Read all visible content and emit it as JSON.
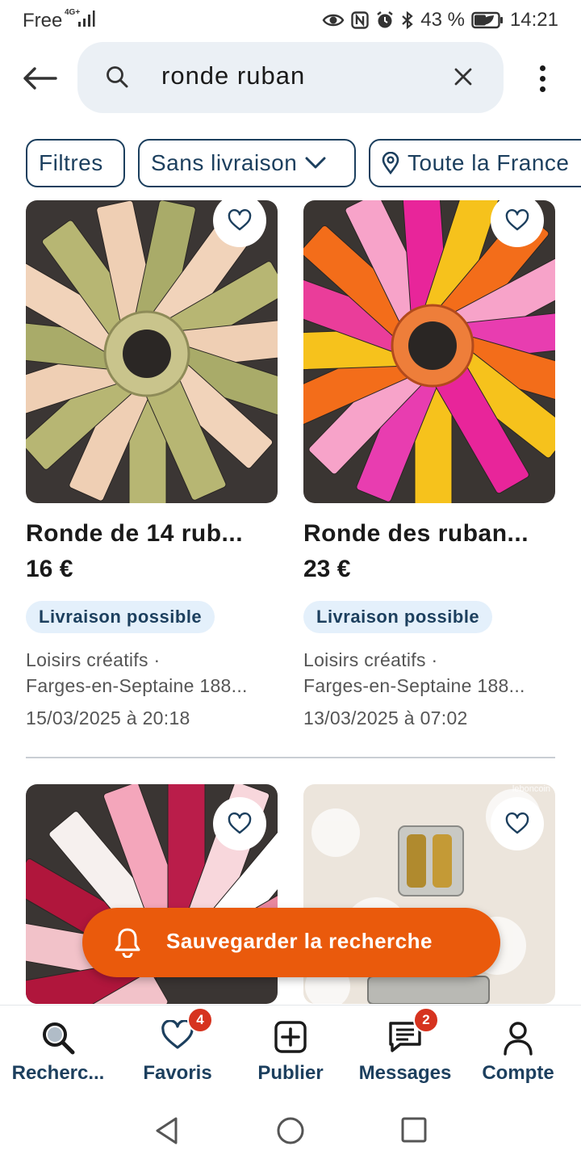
{
  "status_bar": {
    "carrier": "Free",
    "network": "4G+",
    "battery": "43 %",
    "time": "14:21"
  },
  "search": {
    "query": "ronde ruban"
  },
  "filters": {
    "filters_label": "Filtres",
    "delivery_label": "Sans livraison",
    "location_label": "Toute la France"
  },
  "listings": [
    {
      "title": "Ronde de 14 rub...",
      "price": "16 €",
      "badge": "Livraison possible",
      "category": "Loisirs créatifs ·",
      "location": "Farges-en-Septaine 188...",
      "date": "15/03/2025 à 20:18"
    },
    {
      "title": "Ronde des ruban...",
      "price": "23 €",
      "badge": "Livraison possible",
      "category": "Loisirs créatifs ·",
      "location": "Farges-en-Septaine 188...",
      "date": "13/03/2025 à 07:02"
    },
    {
      "watermark": ""
    },
    {
      "watermark": "leboncoin"
    }
  ],
  "save_search": {
    "label": "Sauvegarder la recherche"
  },
  "bottom_nav": {
    "items": [
      {
        "label": "Recherc...",
        "icon": "search-icon"
      },
      {
        "label": "Favoris",
        "icon": "heart-icon",
        "badge": "4"
      },
      {
        "label": "Publier",
        "icon": "plus-square-icon"
      },
      {
        "label": "Messages",
        "icon": "message-icon",
        "badge": "2"
      },
      {
        "label": "Compte",
        "icon": "user-icon"
      }
    ]
  },
  "colors": {
    "accent": "#ea5a0c",
    "primary": "#1c3f5e",
    "badge_bg": "#e4f0fb",
    "notification": "#d6331f"
  }
}
